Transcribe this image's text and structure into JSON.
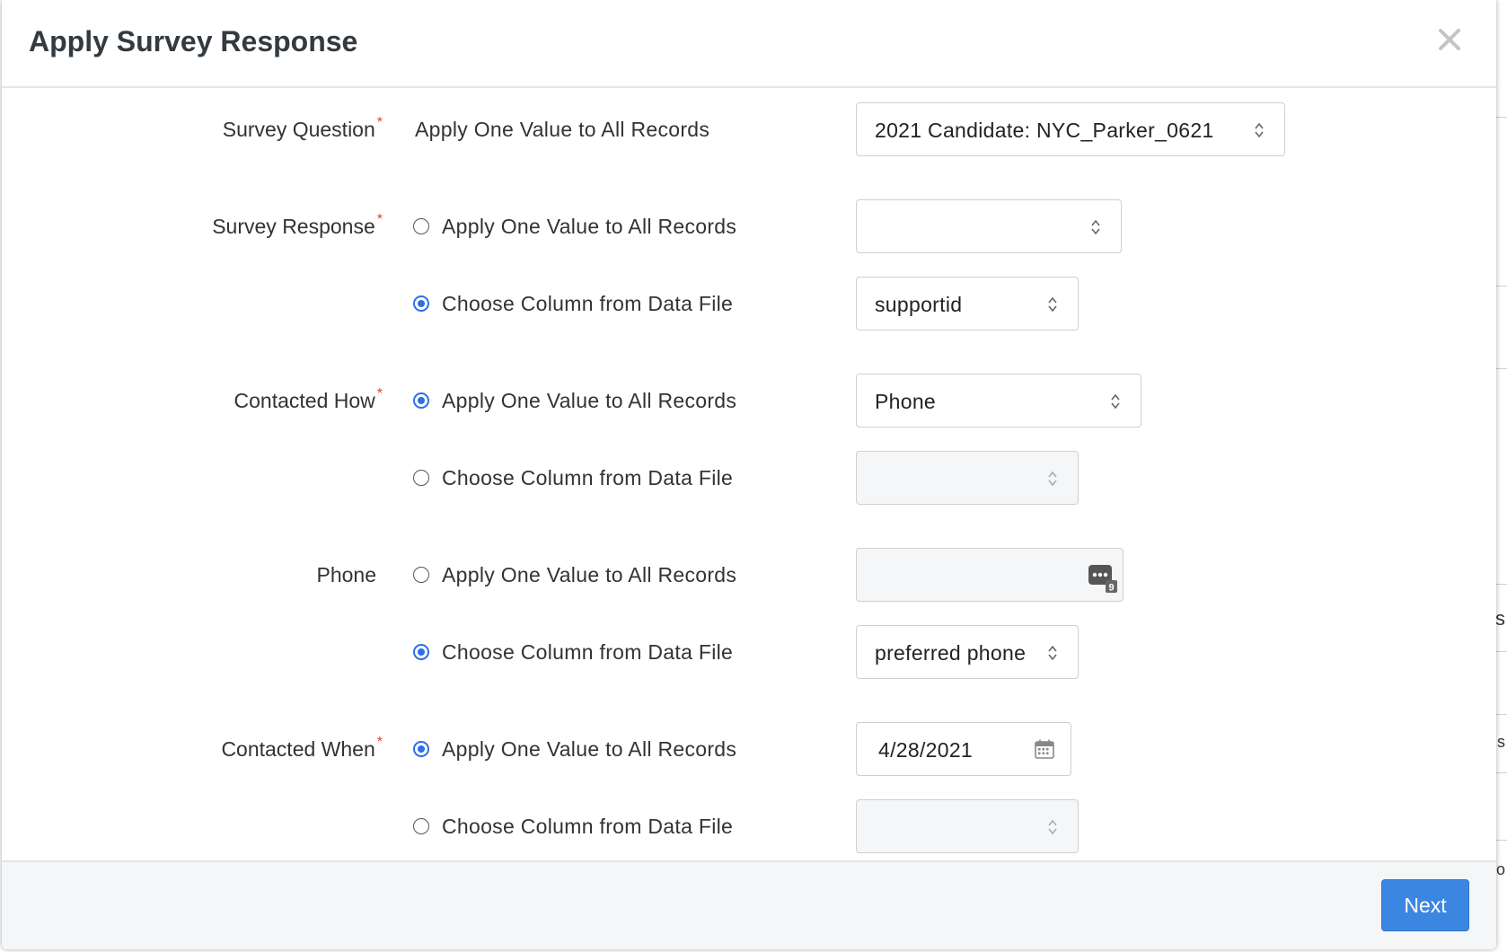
{
  "dialog": {
    "title": "Apply Survey Response",
    "close_icon": "close-icon"
  },
  "fields": {
    "survey_question": {
      "label": "Survey Question",
      "option_text": "Apply One Value to All Records",
      "value": "2021 Candidate: NYC_Parker_0621"
    },
    "survey_response": {
      "label": "Survey Response",
      "option_apply": "Apply One Value to All Records",
      "option_column": "Choose Column from Data File",
      "apply_value": "",
      "column_value": "supportid",
      "selected": "column"
    },
    "contacted_how": {
      "label": "Contacted How",
      "option_apply": "Apply One Value to All Records",
      "option_column": "Choose Column from Data File",
      "apply_value": "Phone",
      "column_value": "",
      "selected": "apply"
    },
    "phone": {
      "label": "Phone",
      "option_apply": "Apply One Value to All Records",
      "option_column": "Choose Column from Data File",
      "apply_value": "",
      "apply_badge": "9",
      "column_value": "preferred phone",
      "selected": "column"
    },
    "contacted_when": {
      "label": "Contacted When",
      "option_apply": "Apply One Value to All Records",
      "option_column": "Choose Column from Data File",
      "apply_value": "4/28/2021",
      "column_value": "",
      "selected": "apply"
    }
  },
  "required_mark": "*",
  "footer": {
    "next_label": "Next"
  },
  "backdrop": {
    "edge_letters": [
      "s",
      "s",
      "o"
    ]
  },
  "colors": {
    "primary": "#3b86e0",
    "radio_checked": "#2c6fe6",
    "required": "#e0403a",
    "footer_bg": "#f5f6f8"
  }
}
